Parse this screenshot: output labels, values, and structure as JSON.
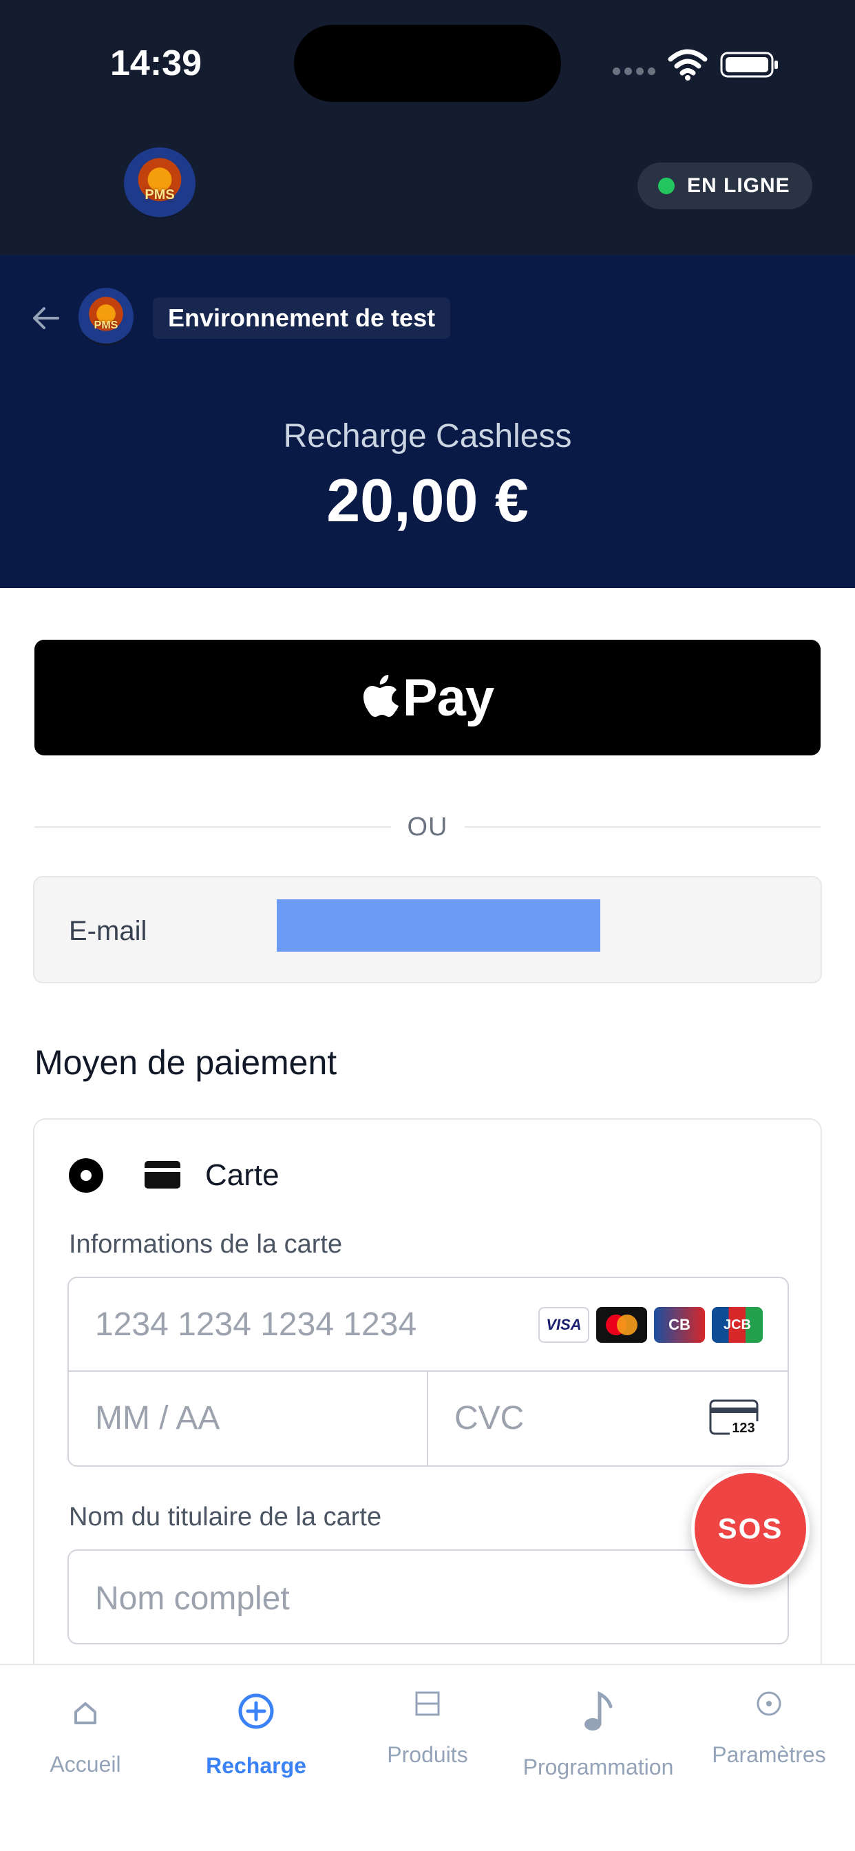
{
  "status_bar": {
    "time": "14:39"
  },
  "header": {
    "logo_text": "PMS",
    "online_label": "EN LIGNE"
  },
  "hero": {
    "logo_text": "PMS",
    "environment_badge": "Environnement de test",
    "subtitle": "Recharge Cashless",
    "amount": "20,00 €"
  },
  "apple_pay": {
    "label": "Pay"
  },
  "divider": {
    "label": "OU"
  },
  "email": {
    "label": "E-mail",
    "value": ""
  },
  "payment": {
    "section_title": "Moyen de paiement",
    "method_label": "Carte",
    "card_info_label": "Informations de la carte",
    "card_number_placeholder": "1234 1234 1234 1234",
    "brands": [
      "VISA",
      "",
      "CB",
      "JCB"
    ],
    "expiry_placeholder": "MM / AA",
    "cvc_placeholder": "CVC",
    "cvc_icon_text": "123",
    "cardholder_label": "Nom du titulaire de la carte",
    "cardholder_placeholder": "Nom complet"
  },
  "sos": {
    "label": "SOS"
  },
  "tabs": [
    {
      "label": "Accueil",
      "icon": "home-icon",
      "active": false
    },
    {
      "label": "Recharge",
      "icon": "plus-circle-icon",
      "active": true
    },
    {
      "label": "Produits",
      "icon": "box-icon",
      "active": false
    },
    {
      "label": "Programmation",
      "icon": "music-note-icon",
      "active": false
    },
    {
      "label": "Paramètres",
      "icon": "settings-icon",
      "active": false
    }
  ],
  "colors": {
    "header_bg": "#141c2f",
    "hero_bg": "#0a1a47",
    "accent": "#3b82f6",
    "online_dot": "#22c55e",
    "sos": "#ef4444"
  }
}
